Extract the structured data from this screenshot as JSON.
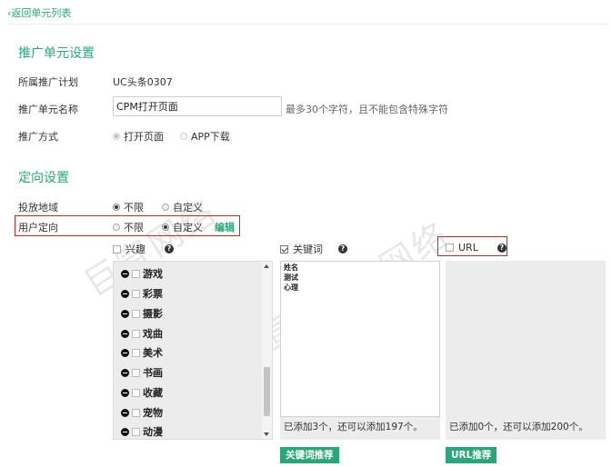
{
  "back_link": {
    "icon": "chevron-left-icon",
    "label": "返回单元列表"
  },
  "unit_settings": {
    "title": "推广单元设置",
    "plan": {
      "label": "所属推广计划",
      "value": "UC头条0307"
    },
    "name": {
      "label": "推广单元名称",
      "value": "CPM打开页面",
      "hint": "最多30个字符，且不能包含特殊字符"
    },
    "method": {
      "label": "推广方式",
      "options": [
        {
          "label": "打开页面",
          "selected": true
        },
        {
          "label": "APP下载",
          "selected": false
        }
      ]
    }
  },
  "targeting": {
    "title": "定向设置",
    "region": {
      "label": "投放地域",
      "options": [
        {
          "label": "不限",
          "selected": true
        },
        {
          "label": "自定义",
          "selected": false
        }
      ]
    },
    "user": {
      "label": "用户定向",
      "options": [
        {
          "label": "不限",
          "selected": false
        },
        {
          "label": "自定义",
          "selected": true
        }
      ],
      "edit_label": "编辑"
    },
    "interest": {
      "label": "兴趣",
      "checked": false,
      "help_icon": "help-icon",
      "items": [
        "游戏",
        "彩票",
        "摄影",
        "戏曲",
        "美术",
        "书画",
        "收藏",
        "宠物",
        "动漫"
      ]
    },
    "keyword": {
      "label": "关键词",
      "checked": true,
      "help_icon": "help-icon",
      "value": "姓名\n测试\n心理",
      "count_text": "已添加3个，还可以添加197个。",
      "button": "关键词推荐"
    },
    "url": {
      "label": "URL",
      "checked": false,
      "help_icon": "help-icon",
      "count_text": "已添加0个，还可以添加200个。",
      "button": "URL推荐"
    }
  },
  "watermark": [
    "巨宣网络",
    "巨宣网络",
    "巨宣网络"
  ],
  "colors": {
    "accent": "#2aa779",
    "highlight_border": "#e02020",
    "panel_bg": "#ececec"
  }
}
